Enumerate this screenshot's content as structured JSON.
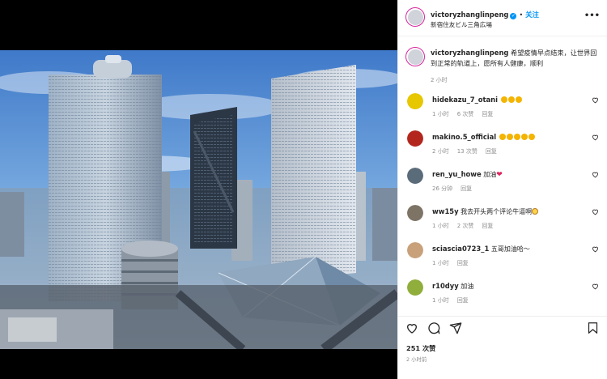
{
  "post": {
    "username": "victoryzhanglinpeng",
    "separator": "•",
    "follow_label": "关注",
    "location": "新宿住友ビル三角広場",
    "more_label": "•••",
    "caption_username": "victoryzhanglinpeng",
    "caption_text": "希望疫情早点结束，让世界回到正常的轨道上，愿所有人健康，顺利",
    "caption_time": "2 小时",
    "likes": "251 次赞",
    "post_time": "2 小时前"
  },
  "comments": [
    {
      "username": "hidekazu_7_otani",
      "text": "",
      "emoji": "clap",
      "emoji_count": 3,
      "time": "1 小时",
      "likes": "6 次赞",
      "reply": "回复",
      "avatar_color": "#e6c700"
    },
    {
      "username": "makino.5_official",
      "text": "",
      "emoji": "clap",
      "emoji_count": 5,
      "time": "2 小时",
      "likes": "13 次赞",
      "reply": "回复",
      "avatar_color": "#b3261e"
    },
    {
      "username": "ren_yu_howe",
      "text": "加油",
      "emoji": "red-heart",
      "emoji_count": 1,
      "time": "26 分钟",
      "likes": "",
      "reply": "回复",
      "avatar_color": "#5a6b7a"
    },
    {
      "username": "ww15y",
      "text": "我去开头两个评论牛逼啊",
      "emoji": "laugh",
      "emoji_count": 1,
      "time": "1 小时",
      "likes": "2 次赞",
      "reply": "回复",
      "avatar_color": "#7d7466"
    },
    {
      "username": "sciascia0723_1",
      "text": "五哥加油哈～",
      "emoji": "",
      "emoji_count": 0,
      "time": "1 小时",
      "likes": "",
      "reply": "回复",
      "avatar_color": "#c8a07a"
    },
    {
      "username": "r10dyy",
      "text": "加油",
      "emoji": "",
      "emoji_count": 0,
      "time": "1 小时",
      "likes": "",
      "reply": "回复",
      "avatar_color": "#8fae3c"
    }
  ],
  "verified_mark": "✓",
  "icons": [
    "heart-icon",
    "comment-icon",
    "share-icon",
    "bookmark-icon",
    "more-icon",
    "verified-badge-icon"
  ],
  "colors": {
    "link_blue": "#0095f6",
    "muted": "#8e8e8e",
    "text": "#262626",
    "story_ring": "#d6249f"
  }
}
